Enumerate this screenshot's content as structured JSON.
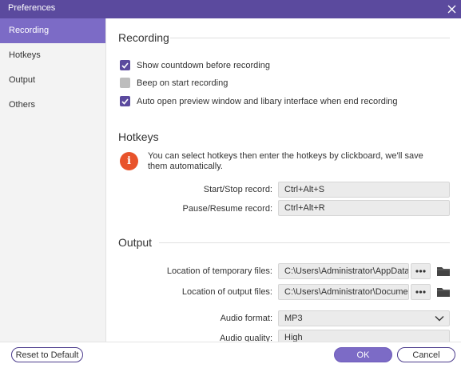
{
  "window": {
    "title": "Preferences"
  },
  "sidebar": {
    "items": [
      {
        "label": "Recording"
      },
      {
        "label": "Hotkeys"
      },
      {
        "label": "Output"
      },
      {
        "label": "Others"
      }
    ]
  },
  "recording": {
    "title": "Recording",
    "options": [
      {
        "label": "Show countdown before recording",
        "checked": true
      },
      {
        "label": "Beep on start recording",
        "checked": false
      },
      {
        "label": "Auto open preview window and libary interface when end recording",
        "checked": true
      }
    ]
  },
  "hotkeys": {
    "title": "Hotkeys",
    "info": "You can select hotkeys then enter the hotkeys by clickboard, we'll save them automatically.",
    "start_stop_label": "Start/Stop record:",
    "start_stop_value": "Ctrl+Alt+S",
    "pause_resume_label": "Pause/Resume record:",
    "pause_resume_value": "Ctrl+Alt+R"
  },
  "output": {
    "title": "Output",
    "temp_label": "Location of temporary files:",
    "temp_value": "C:\\Users\\Administrator\\AppData\\Lo",
    "output_label": "Location of output files:",
    "output_value": "C:\\Users\\Administrator\\Documents",
    "audio_format_label": "Audio format:",
    "audio_format_value": "MP3",
    "audio_quality_label": "Audio quality:",
    "audio_quality_value": "High"
  },
  "footer": {
    "reset_label": "Reset to Default",
    "ok_label": "OK",
    "cancel_label": "Cancel"
  },
  "colors": {
    "accent": "#5b4a9e",
    "sidebar_active": "#7c6bc6",
    "info": "#e8532b"
  }
}
